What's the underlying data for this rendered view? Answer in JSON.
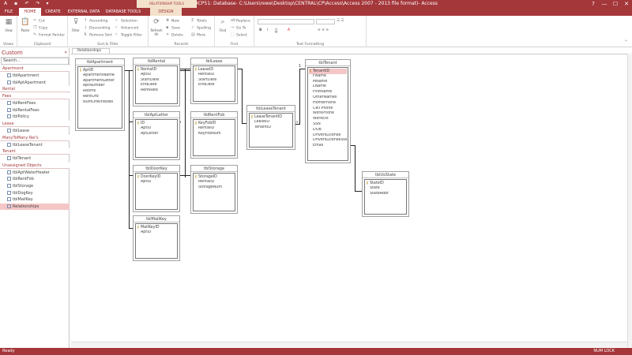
{
  "app": {
    "title": "HCP51: Database- C:\\Users\\rewe\\Desktop\\CENTRAL\\CP\\Access\\Access 2007 - 2013 file format)- Access",
    "window_controls": [
      "?",
      "—",
      "☐",
      "✕"
    ]
  },
  "ribbon": {
    "context_label": "RELATIONSHIP TOOLS",
    "tabs": [
      "FILE",
      "HOME",
      "CREATE",
      "EXTERNAL DATA",
      "DATABASE TOOLS",
      "DESIGN"
    ],
    "groups": {
      "views": {
        "label": "Views",
        "view_btn": "View"
      },
      "clipboard": {
        "label": "Clipboard",
        "paste_btn": "Paste",
        "cut": "Cut",
        "copy": "Copy",
        "format_painter": "Format Painter"
      },
      "sort_filter": {
        "label": "Sort & Filter",
        "filter_btn": "Filter",
        "ascending": "Ascending",
        "descending": "Descending",
        "remove_sort": "Remove Sort",
        "selection": "Selection",
        "advanced": "Advanced",
        "toggle_filter": "Toggle Filter"
      },
      "records": {
        "label": "Records",
        "refresh_btn": "Refresh All",
        "new": "New",
        "save": "Save",
        "delete": "Delete",
        "totals": "Totals",
        "spelling": "Spelling",
        "more": "More"
      },
      "find": {
        "label": "Find",
        "find_btn": "Find",
        "replace": "Replace",
        "goto": "Go To",
        "select": "Select"
      },
      "text_formatting": {
        "label": "Text Formatting",
        "bold": "B",
        "italic": "I",
        "underline": "U",
        "font_color": "A"
      }
    }
  },
  "nav": {
    "header": "Custom",
    "search_placeholder": "Search...",
    "items": [
      {
        "type": "group",
        "label": "Apartment"
      },
      {
        "type": "object",
        "label": "tblApartment"
      },
      {
        "type": "object",
        "label": "tblAptApartment"
      },
      {
        "type": "group",
        "label": "Rental"
      },
      {
        "type": "group",
        "label": "Fees"
      },
      {
        "type": "object",
        "label": "tblRentFees"
      },
      {
        "type": "object",
        "label": "tblRentalFees"
      },
      {
        "type": "object",
        "label": "tblPolicy"
      },
      {
        "type": "group",
        "label": "Lease"
      },
      {
        "type": "object",
        "label": "tblLease"
      },
      {
        "type": "group",
        "label": "ManyToMany Rel's"
      },
      {
        "type": "object",
        "label": "tblLeaseTenant"
      },
      {
        "type": "group",
        "label": "Tenant"
      },
      {
        "type": "object",
        "label": "tblTenant"
      },
      {
        "type": "group",
        "label": "Unassigned Objects"
      },
      {
        "type": "object",
        "label": "tblAptWaterHeater"
      },
      {
        "type": "object",
        "label": "tblRentFob"
      },
      {
        "type": "object",
        "label": "tblStorage"
      },
      {
        "type": "object",
        "label": "tblDogKey"
      },
      {
        "type": "object",
        "label": "tblMailKey"
      },
      {
        "type": "object",
        "label": "Relationships",
        "selected": true
      }
    ]
  },
  "document_tab": "Relationships",
  "tables": [
    {
      "title": "tblApartment",
      "fields": [
        {
          "n": "AptID",
          "k": true
        },
        {
          "n": "ApartmentName"
        },
        {
          "n": "ApartmentLetter"
        },
        {
          "n": "AptNumber"
        },
        {
          "n": "Rooms"
        },
        {
          "n": "RentOrd"
        },
        {
          "n": "NumOfWindows"
        }
      ]
    },
    {
      "title": "tblRental",
      "fields": [
        {
          "n": "RentalID",
          "k": true
        },
        {
          "n": "AptID"
        },
        {
          "n": "StartDate"
        },
        {
          "n": "EndDate"
        },
        {
          "n": "RentRate"
        }
      ]
    },
    {
      "title": "tblLease",
      "fields": [
        {
          "n": "LeaseID",
          "k": true
        },
        {
          "n": "RentalID"
        },
        {
          "n": "StartDate"
        },
        {
          "n": "EndDate"
        }
      ]
    },
    {
      "title": "tblAptLetter",
      "fields": [
        {
          "n": "ID",
          "k": true
        },
        {
          "n": "AptID"
        },
        {
          "n": "AptLetter"
        }
      ]
    },
    {
      "title": "tblRentFob",
      "fields": [
        {
          "n": "KeyFobID",
          "k": true
        },
        {
          "n": "RentalID"
        },
        {
          "n": "KeyFobNum"
        }
      ]
    },
    {
      "title": "tblLeaseTenant",
      "fields": [
        {
          "n": "LeaseTenantID",
          "k": true
        },
        {
          "n": "LeaseID"
        },
        {
          "n": "TenantID"
        }
      ]
    },
    {
      "title": "tblTenant",
      "fields": [
        {
          "n": "TenantID",
          "k": true,
          "hl": true
        },
        {
          "n": "FName"
        },
        {
          "n": "MName"
        },
        {
          "n": "LName"
        },
        {
          "n": "FirstName"
        },
        {
          "n": "OtherNames"
        },
        {
          "n": "HomePhone"
        },
        {
          "n": "Cell Phone"
        },
        {
          "n": "WorkPhone"
        },
        {
          "n": "WorkExt"
        },
        {
          "n": "SSN"
        },
        {
          "n": "DOB"
        },
        {
          "n": "DriversLicense"
        },
        {
          "n": "DriversLicenseState"
        },
        {
          "n": "Email"
        }
      ]
    },
    {
      "title": "tblDoorKey",
      "fields": [
        {
          "n": "DoorKeyID",
          "k": true
        },
        {
          "n": "AptID"
        }
      ]
    },
    {
      "title": "tblStorage",
      "fields": [
        {
          "n": "StorageID",
          "k": true
        },
        {
          "n": "RentalID"
        },
        {
          "n": "StorageNum"
        }
      ]
    },
    {
      "title": "tblUsState",
      "fields": [
        {
          "n": "StateID",
          "k": true
        },
        {
          "n": "State"
        },
        {
          "n": "StateAbbr"
        }
      ]
    },
    {
      "title": "tblMailKey",
      "fields": [
        {
          "n": "MailKeyID",
          "k": true
        },
        {
          "n": "AptID"
        }
      ]
    }
  ],
  "relationship_labels": {
    "one": "1",
    "many": "∞"
  },
  "status": {
    "left": "Ready",
    "right": "NUM LOCK"
  }
}
